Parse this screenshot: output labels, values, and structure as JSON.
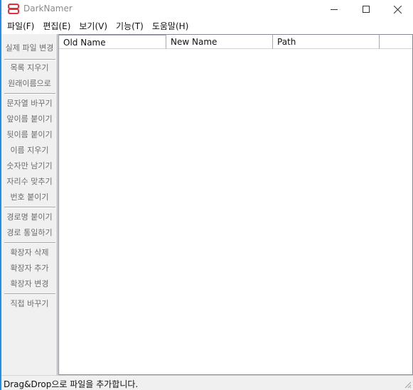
{
  "window": {
    "title": "DarkNamer",
    "accent_color": "#2b8be0",
    "app_icon": "red-stacked-rectangles-icon"
  },
  "menu": {
    "items": [
      "파일(F)",
      "편집(E)",
      "보기(V)",
      "기능(T)",
      "도움말(H)"
    ]
  },
  "sidebar": {
    "items": [
      {
        "label": "실제 파일 변경"
      },
      {
        "label": "목록 지우기"
      },
      {
        "label": "원래이름으로"
      },
      {
        "label": "문자열 바꾸기"
      },
      {
        "label": "앞이름 붙이기"
      },
      {
        "label": "뒷이름 붙이기"
      },
      {
        "label": "이름 지우기"
      },
      {
        "label": "숫자만 남기기"
      },
      {
        "label": "자리수 맞추기"
      },
      {
        "label": "번호 붙이기"
      },
      {
        "label": "경로명 붙이기"
      },
      {
        "label": "경로 통일하기"
      },
      {
        "label": "확장자 삭제"
      },
      {
        "label": "확장자 추가"
      },
      {
        "label": "확장자 변경"
      },
      {
        "label": "직접 바꾸기"
      }
    ]
  },
  "list": {
    "columns": [
      "Old Name",
      "New Name",
      "Path"
    ],
    "rows": []
  },
  "status": {
    "text": "Drag&Drop으로 파일을 추가합니다."
  }
}
